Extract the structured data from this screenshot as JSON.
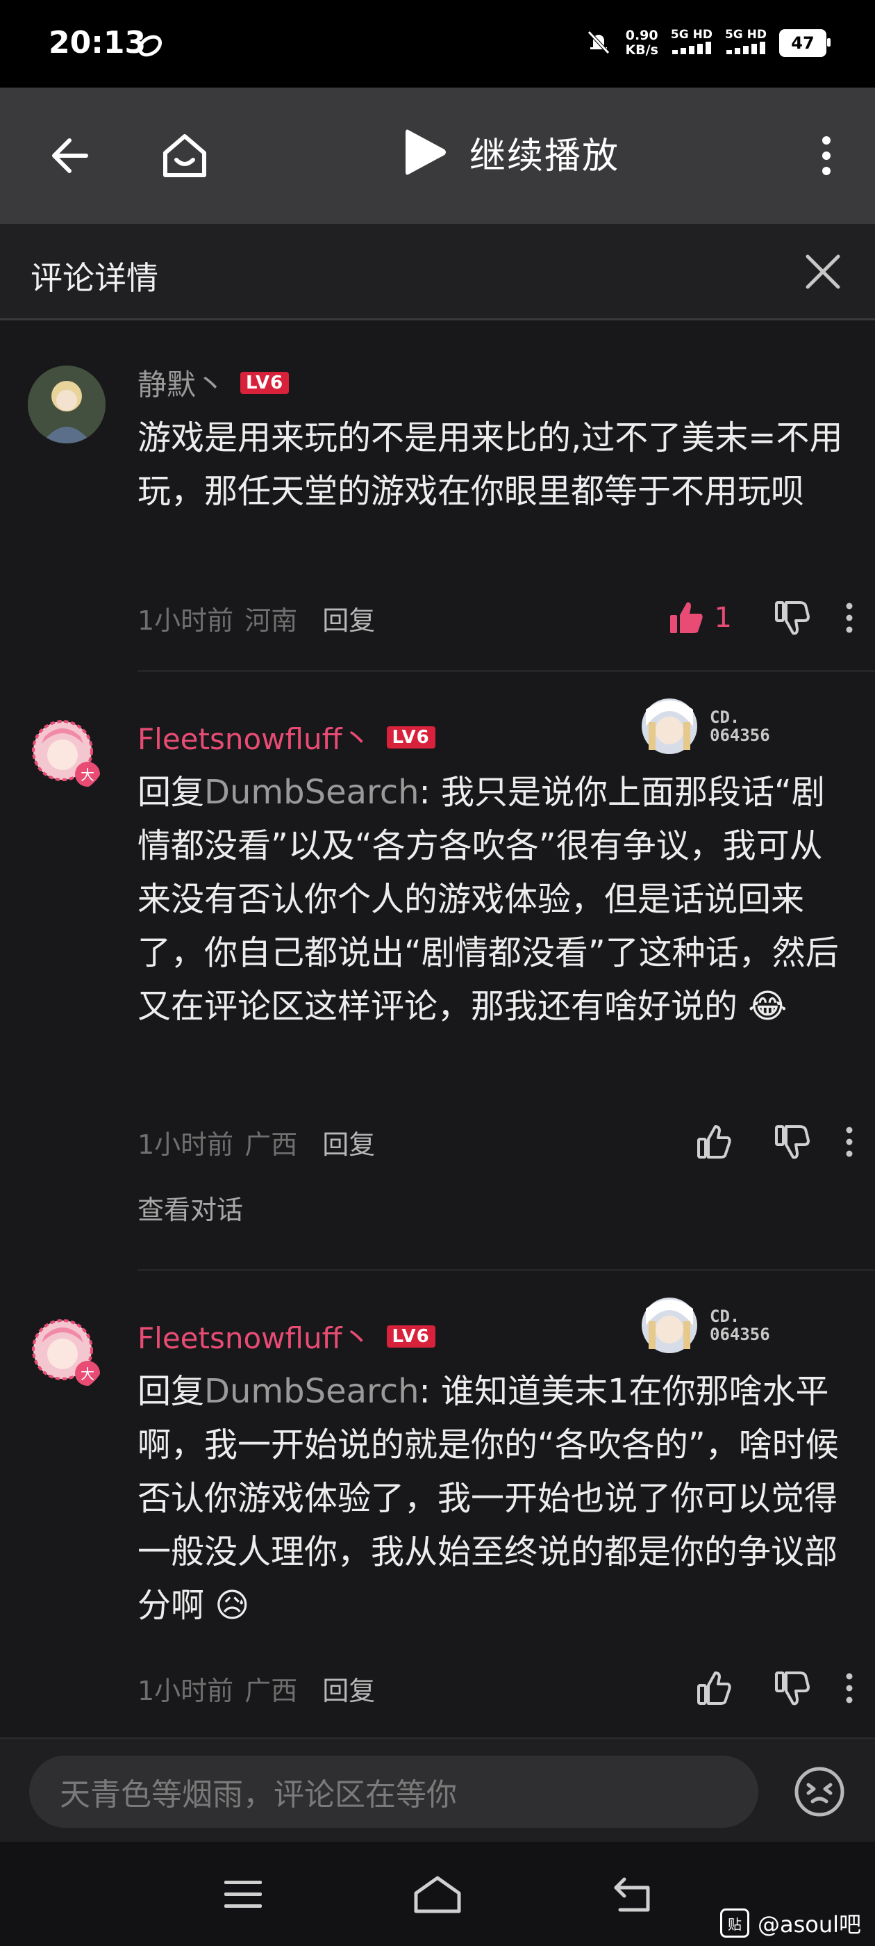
{
  "status_bar": {
    "time": "20:13",
    "speed_value": "0.90",
    "speed_unit": "KB/s",
    "sim1": "5G HD",
    "sim2": "5G HD",
    "battery": "47"
  },
  "top_nav": {
    "play_label": "继续播放"
  },
  "panel": {
    "title": "评论详情"
  },
  "comments": [
    {
      "username": "静默丶",
      "username_color": "#9a9a9a",
      "level": "LV6",
      "reply_prefix": "",
      "reply_to": "",
      "text": "游戏是用来玩的不是用来比的,过不了美末=不用玩，那任天堂的游戏在你眼里都等于不用玩呗",
      "time": "1小时前",
      "location": "河南",
      "reply_label": "回复",
      "like_count": "1",
      "liked": true
    },
    {
      "username": "Fleetsnowfluff丶",
      "username_color": "#e84c74",
      "level": "LV6",
      "badge_code_line1": "CD.",
      "badge_code_line2": "064356",
      "reply_prefix": "回复",
      "reply_to": "DumbSearch",
      "text": ": 我只是说你上面那段话“剧情都没看”以及“各方各吹各”很有争议，我可从来没有否认你个人的游戏体验，但是话说回来了，你自己都说出“剧情都没看”了这种话，然后又在评论区这样评论，那我还有啥好说的 😂",
      "time": "1小时前",
      "location": "广西",
      "reply_label": "回复",
      "view_conversation": "查看对话"
    },
    {
      "username": "Fleetsnowfluff丶",
      "username_color": "#e84c74",
      "level": "LV6",
      "badge_code_line1": "CD.",
      "badge_code_line2": "064356",
      "reply_prefix": "回复",
      "reply_to": "DumbSearch",
      "text": ": 谁知道美末1在你那啥水平啊，我一开始说的就是你的“各吹各的”，啥时候否认你游戏体验了，我一开始也说了你可以觉得一般没人理你，我从始至终说的都是你的争议部分啊 😥",
      "time": "1小时前",
      "location": "广西",
      "reply_label": "回复"
    }
  ],
  "input_bar": {
    "placeholder": "天青色等烟雨，评论区在等你"
  },
  "watermark": {
    "icon": "贴",
    "text": "@asoul吧"
  },
  "colors": {
    "background": "#18181a",
    "accent_pink": "#e84c74",
    "level_badge": "#d8213a"
  }
}
